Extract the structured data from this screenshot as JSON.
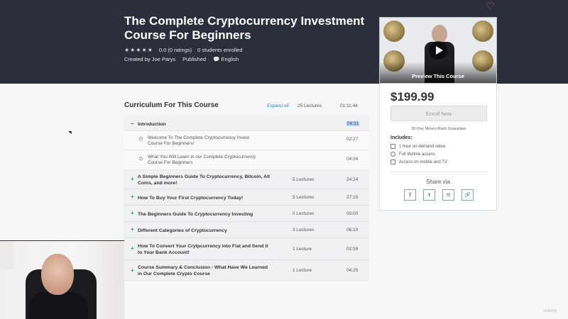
{
  "course": {
    "title": "The Complete Cryptocurrency Investment Course For Beginners",
    "stars": "★★★★★",
    "rating": "0.0 (0 ratings)",
    "students": "0 students enrolled",
    "created_by": "Created by Joe Parys",
    "status": "Published",
    "language": "English"
  },
  "preview": {
    "label": "Preview This Course"
  },
  "purchase": {
    "price": "$199.99",
    "enroll_label": "Enroll Now",
    "guarantee": "30-Day Money-Back Guarantee",
    "includes_heading": "Includes:",
    "includes": [
      "1 hour on-demand video",
      "Full lifetime access",
      "Access on mobile and TV"
    ],
    "share_label": "Share via:",
    "share_buttons": [
      "f",
      "t",
      "✉",
      "🔗"
    ]
  },
  "curriculum": {
    "title": "Curriculum For This Course",
    "expand_label": "Expand All",
    "total_lectures": "25 Lectures",
    "total_duration": "01:11:44",
    "sections": [
      {
        "sign": "−",
        "title": "Introduction",
        "lectures": "",
        "duration": "06:31",
        "expanded": true,
        "items": [
          {
            "title": "Welcome To The Complete Cryptocurrency Invest Course For Beginners!",
            "duration": "02:27"
          },
          {
            "title": "What You Will Learn in our Complete Cryptocurrency Course For Beginners",
            "duration": "04:04"
          }
        ]
      },
      {
        "sign": "+",
        "title": "A Simple Beginners Guide To Cryptocurrency, Bitcoin, Alt Coins, and more!",
        "lectures": "5 Lectures",
        "duration": "24:24"
      },
      {
        "sign": "+",
        "title": "How To Buy Your First Cryptocurrency Today!",
        "lectures": "5 Lectures",
        "duration": "27:15"
      },
      {
        "sign": "+",
        "title": "The Beginners Guide To Cryptocurrency Investing",
        "lectures": "0 Lectures",
        "duration": "00:00"
      },
      {
        "sign": "+",
        "title": "Different Categories of Cryptocurrency",
        "lectures": "3 Lectures",
        "duration": "06:10"
      },
      {
        "sign": "+",
        "title": "How To Convert Your Crytpcurrency into Fiat and Send it to Your Bank Account!",
        "lectures": "1 Lecture",
        "duration": "02:59"
      },
      {
        "sign": "+",
        "title": "Course Summary & Conclusion - What Have We Learned in Our Complete Crypto Course",
        "lectures": "1 Lecture",
        "duration": "04:25"
      }
    ]
  },
  "watermark": "udemy",
  "colors": {
    "header_bg": "#2b2f3c",
    "accent_link": "#2a8bc9",
    "section_plus": "#2e9f72",
    "highlight": "#b7d1e9"
  }
}
